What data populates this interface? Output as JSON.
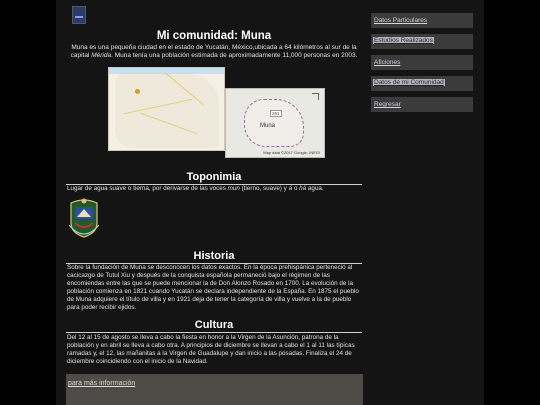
{
  "header": {
    "title": "Mi comunidad: Muna"
  },
  "intro": {
    "text_before": "Muna es una pequeña ciudad en el estado de Yucatán, México,ubicada a 64 kilómetros al sur de la capital ",
    "italic": "Mérida",
    "text_after": ". Muna tenía una población estimada de aproximadamente 11,000 personas en 2003."
  },
  "map": {
    "town_label": "Muna",
    "highway_label": "261",
    "credit": "Map data ©2017 Google, INEGI"
  },
  "toponimia": {
    "title": "Toponimia",
    "text_before": "Lugar de agua suave o tierna, por derivarse de las voces ",
    "italic1": "mun",
    "text_middle": " (tierno, suave) y ",
    "italic2": "á",
    "text_or": " o ",
    "italic3": "há",
    "text_after": " agua."
  },
  "historia": {
    "title": "Historia",
    "text": "Sobre la fundación de Muna se desconocen los datos exactos. En la época prehispánica perteneció al cacicazgo de Tutul Xiu y después de la conquista española permaneció bajo el régimen de las encomiendas entre las que se puede mencionar la de Don Alonzo Rosado en 1700. La evolución de la población comienza en 1821 cuando Yucatán se declara independiente de la España. En 1875 el pueblo de Muna adquiere el título de villa y en 1921 deja de tener la categoría de villa y vuelve a la de pueblo para poder recibir ejidos."
  },
  "cultura": {
    "title": "Cultura",
    "text": "Del 12 al 15 de agosto se lleva a cabo la fiesta en honor a la Virgen de la Asunción, patrona de la población y en abril se lleva a cabo otra. A principios de diciembre se llevan a cabo el 1 al 11 las típicas ramadas y, el 12, las mañanitas a la Virgen de Guadalupe y dan inicio a las posadas. Finaliza el 24 de diciembre coincidiendo con el inicio de la Navidad."
  },
  "footer": {
    "more_link": "para más información"
  },
  "sidebar": {
    "items": [
      {
        "label": "Datos Particulares"
      },
      {
        "label": "Estudios Realizados"
      },
      {
        "label": "Aficiones"
      },
      {
        "label": "Datos de mi Comunidad"
      },
      {
        "label": "Regresar"
      }
    ]
  },
  "colors": {
    "background": "#000000",
    "panel": "#141414",
    "sidebar_item": "#3b3b3b",
    "footer_box": "#4e4a45"
  }
}
